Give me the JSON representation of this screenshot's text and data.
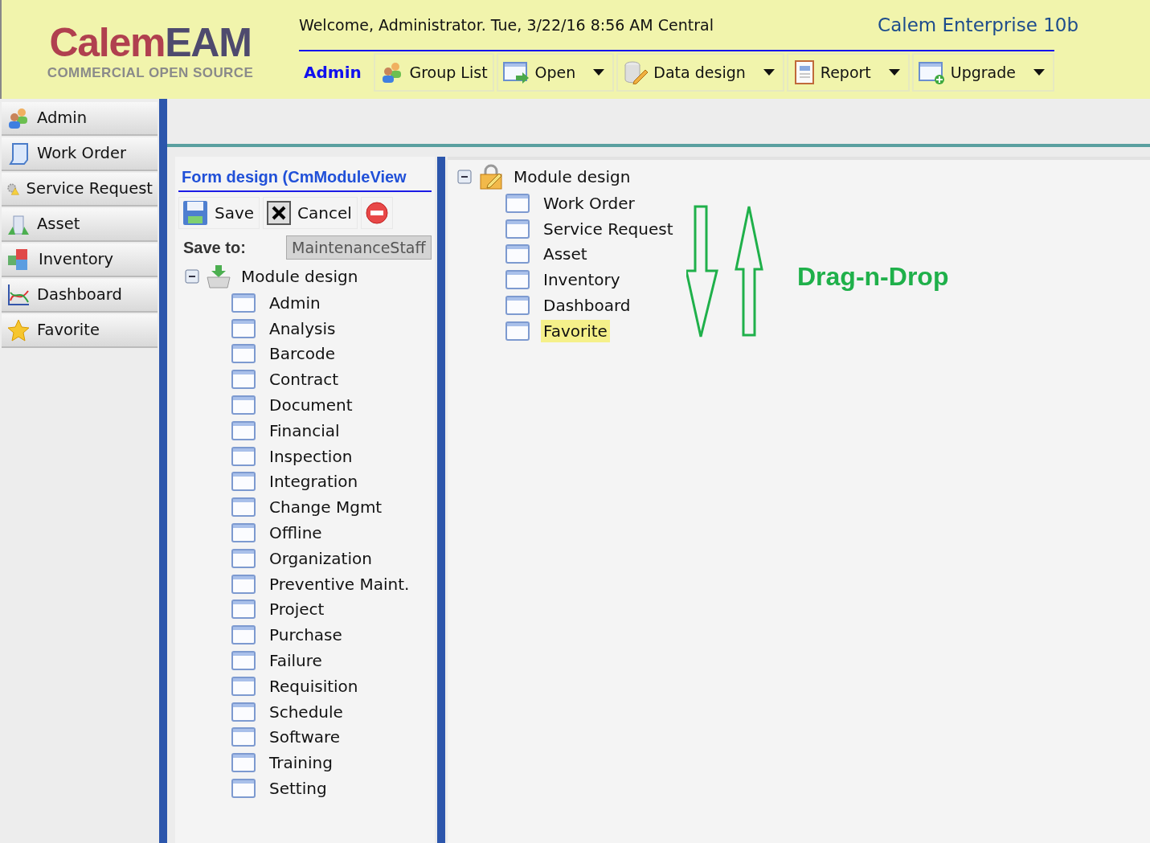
{
  "header": {
    "logo": {
      "first": "Calem",
      "second": "EAM",
      "tagline": "COMMERCIAL OPEN SOURCE"
    },
    "welcome": "Welcome, Administrator. Tue, 3/22/16 8:56 AM Central",
    "product": "Calem Enterprise 10b"
  },
  "toolbar": [
    {
      "label": "Admin",
      "kind": "title"
    },
    {
      "label": "Group List",
      "kind": "menu",
      "dropdown": false
    },
    {
      "label": "Open",
      "kind": "menu",
      "dropdown": true
    },
    {
      "label": "Data design",
      "kind": "menu",
      "dropdown": true
    },
    {
      "label": "Report",
      "kind": "menu",
      "dropdown": true
    },
    {
      "label": "Upgrade",
      "kind": "menu",
      "dropdown": true
    }
  ],
  "sidebar": {
    "items": [
      {
        "label": "Admin"
      },
      {
        "label": "Work Order"
      },
      {
        "label": "Service Request"
      },
      {
        "label": "Asset"
      },
      {
        "label": "Inventory"
      },
      {
        "label": "Dashboard"
      },
      {
        "label": "Favorite"
      }
    ]
  },
  "form": {
    "title": "Form design (CmModuleView",
    "actions": [
      {
        "label": "Save",
        "kind": "save"
      },
      {
        "label": "Cancel",
        "kind": "cancel"
      },
      {
        "kind": "delete"
      }
    ],
    "save_to": {
      "label": "Save to:",
      "value": "MaintenanceStaff"
    },
    "tree": {
      "label": "Module design",
      "expanded": true,
      "children": [
        {
          "label": "Admin"
        },
        {
          "label": "Analysis"
        },
        {
          "label": "Barcode"
        },
        {
          "label": "Contract"
        },
        {
          "label": "Document"
        },
        {
          "label": "Financial"
        },
        {
          "label": "Inspection"
        },
        {
          "label": "Integration"
        },
        {
          "label": "Change Mgmt"
        },
        {
          "label": "Offline"
        },
        {
          "label": "Organization"
        },
        {
          "label": "Preventive Maint."
        },
        {
          "label": "Project"
        },
        {
          "label": "Purchase"
        },
        {
          "label": "Failure"
        },
        {
          "label": "Requisition"
        },
        {
          "label": "Schedule"
        },
        {
          "label": "Software"
        },
        {
          "label": "Training"
        },
        {
          "label": "Setting"
        }
      ]
    }
  },
  "module_tree": {
    "label": "Module design",
    "expanded": true,
    "children": [
      {
        "label": "Work Order",
        "selected": false
      },
      {
        "label": "Service Request",
        "selected": false
      },
      {
        "label": "Asset",
        "selected": false
      },
      {
        "label": "Inventory",
        "selected": false
      },
      {
        "label": "Dashboard",
        "selected": false
      },
      {
        "label": "Favorite",
        "selected": true
      }
    ]
  },
  "annotation": "Drag-n-Drop"
}
